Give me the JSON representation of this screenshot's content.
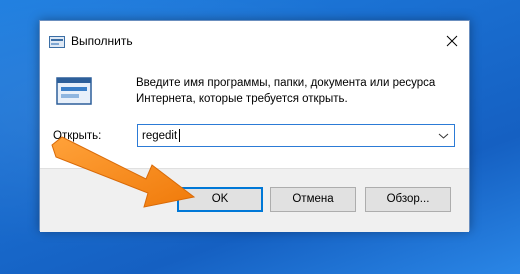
{
  "window": {
    "title": "Выполнить",
    "description": "Введите имя программы, папки, документа или ресурса Интернета, которые требуется открыть.",
    "close_icon": "close-icon",
    "app_icon": "run-icon"
  },
  "form": {
    "open_label": "Открыть:",
    "command_value": "regedit",
    "dropdown_icon": "chevron-down-icon"
  },
  "buttons": {
    "ok_label": "OK",
    "cancel_label": "Отмена",
    "browse_label": "Обзор..."
  },
  "colors": {
    "desktop_blue": "#1a6fd1",
    "accent": "#0078d7",
    "highlight_arrow": "#f5820d"
  }
}
